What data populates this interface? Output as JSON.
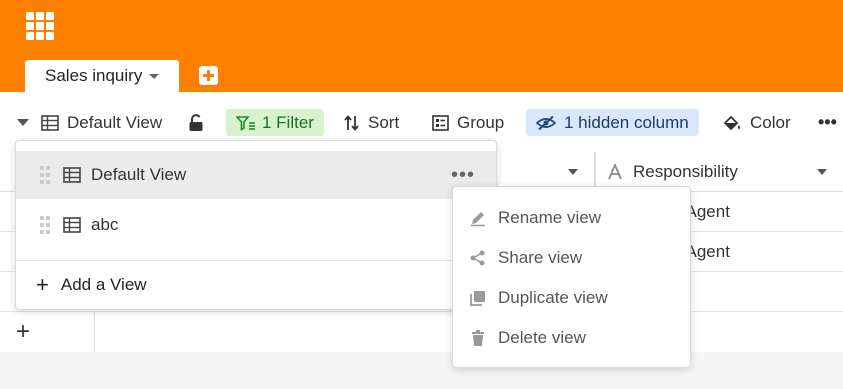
{
  "header": {
    "table_tab": "Sales inquiry"
  },
  "toolbar": {
    "view_name": "Default View",
    "filter": "1 Filter",
    "sort": "Sort",
    "group": "Group",
    "hidden_columns": "1 hidden column",
    "color": "Color",
    "more": "•••"
  },
  "grid": {
    "columns": [
      "",
      "Responsibility"
    ],
    "rows": [
      {
        "responsibility": "/ Agent"
      },
      {
        "responsibility": "/ Agent"
      }
    ],
    "add_row": "+"
  },
  "views_menu": {
    "items": [
      {
        "label": "Default View",
        "more": "•••"
      },
      {
        "label": "abc"
      }
    ],
    "add_view": "Add a View",
    "add_icon": "+"
  },
  "view_actions_menu": {
    "items": [
      {
        "label": "Rename view",
        "icon": "pencil-icon"
      },
      {
        "label": "Share view",
        "icon": "share-icon"
      },
      {
        "label": "Duplicate view",
        "icon": "duplicate-icon"
      },
      {
        "label": "Delete view",
        "icon": "trash-icon"
      }
    ]
  },
  "colors": {
    "brand": "#ff8000",
    "filter_bg": "#d6f2cf",
    "hidden_bg": "#d8e7fb"
  }
}
